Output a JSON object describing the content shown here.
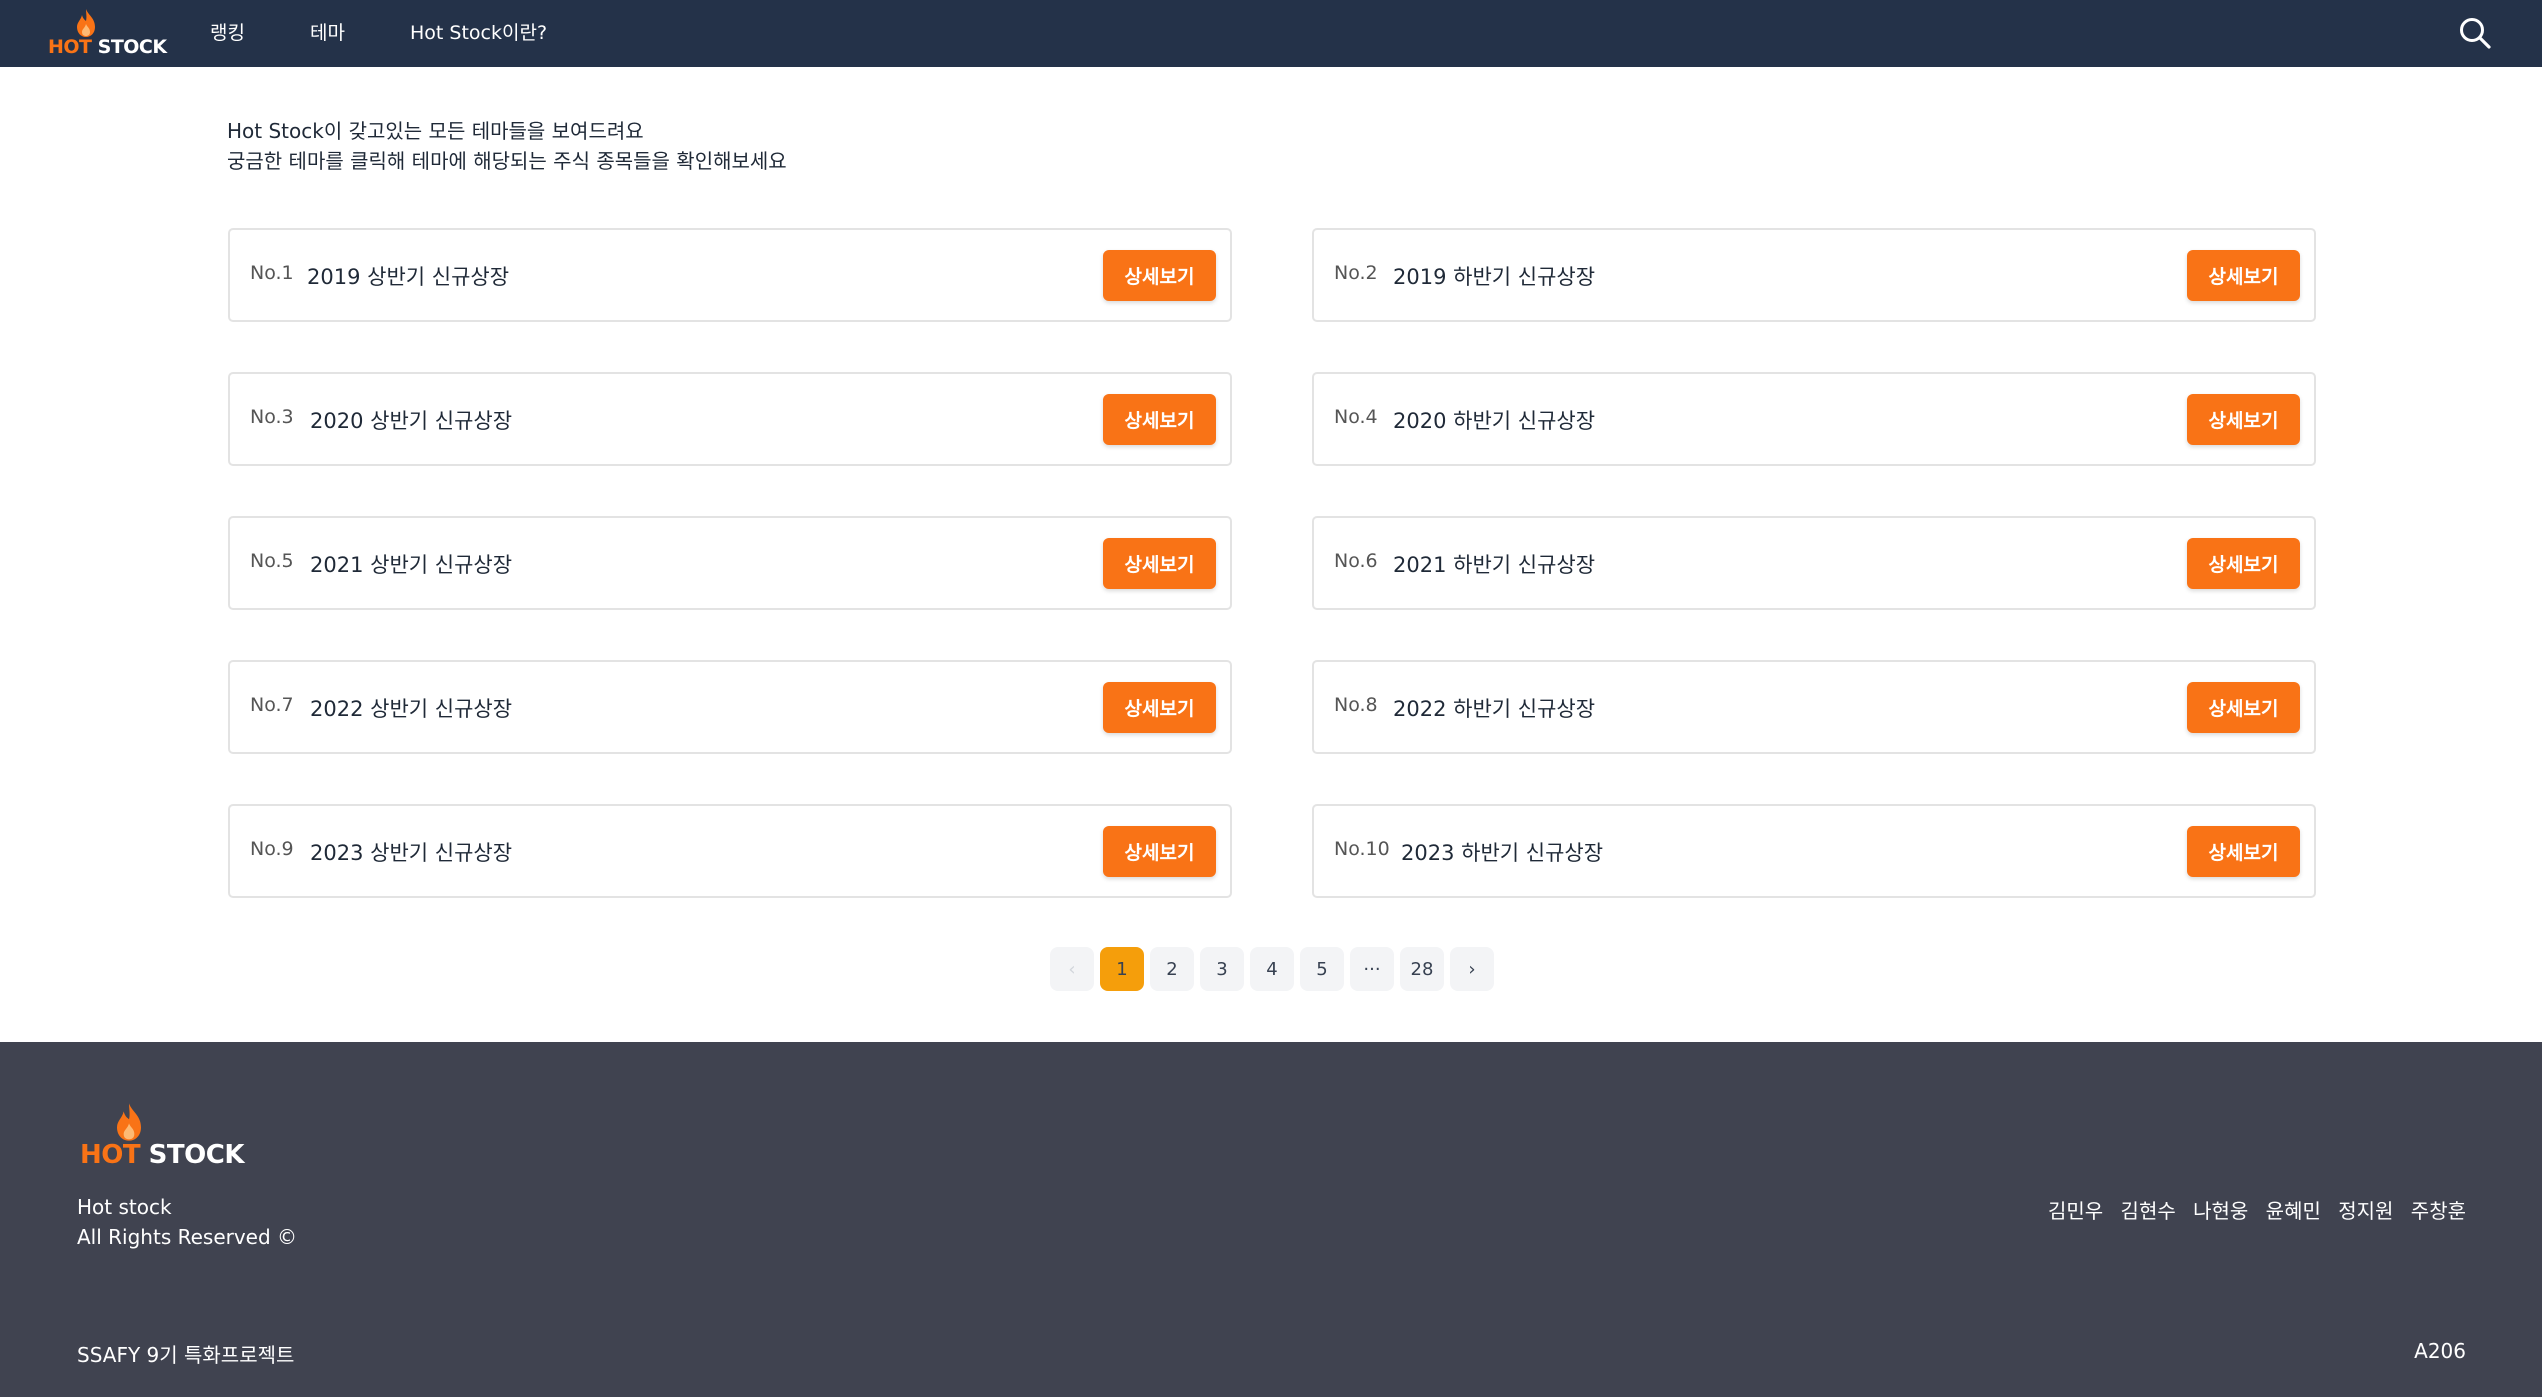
{
  "colors": {
    "header_bg": "#243249",
    "accent": "#f97316",
    "page_active": "#f59e0b",
    "footer_bg": "#404350"
  },
  "header": {
    "logo_hot": "HOT",
    "logo_stock": "STOCK",
    "nav": [
      "랭킹",
      "테마",
      "Hot Stock이란?"
    ],
    "search_icon": "search-icon"
  },
  "intro": {
    "line1": "Hot Stock이 갖고있는 모든 테마들을 보여드려요",
    "line2": "궁금한 테마를 클릭해 테마에 해당되는 주식 종목들을 확인해보세요"
  },
  "themes": [
    {
      "no": "No.1",
      "title": "2019 상반기 신규상장",
      "button": "상세보기"
    },
    {
      "no": "No.2",
      "title": "2019 하반기 신규상장",
      "button": "상세보기"
    },
    {
      "no": "No.3",
      "title": "2020 상반기 신규상장",
      "button": "상세보기"
    },
    {
      "no": "No.4",
      "title": "2020 하반기 신규상장",
      "button": "상세보기"
    },
    {
      "no": "No.5",
      "title": "2021 상반기 신규상장",
      "button": "상세보기"
    },
    {
      "no": "No.6",
      "title": "2021 하반기 신규상장",
      "button": "상세보기"
    },
    {
      "no": "No.7",
      "title": "2022 상반기 신규상장",
      "button": "상세보기"
    },
    {
      "no": "No.8",
      "title": "2022 하반기 신규상장",
      "button": "상세보기"
    },
    {
      "no": "No.9",
      "title": "2023 상반기 신규상장",
      "button": "상세보기"
    },
    {
      "no": "No.10",
      "title": "2023 하반기 신규상장",
      "button": "상세보기"
    }
  ],
  "pagination": {
    "prev": "‹",
    "pages": [
      "1",
      "2",
      "3",
      "4",
      "5",
      "···",
      "28"
    ],
    "next": "›",
    "current": "1"
  },
  "footer": {
    "logo_hot": "HOT",
    "logo_stock": "STOCK",
    "name": "Hot stock",
    "rights": "All Rights Reserved ©",
    "members": [
      "김민우",
      "김현수",
      "나현웅",
      "윤혜민",
      "정지원",
      "주창훈"
    ],
    "project": "SSAFY 9기 특화프로젝트",
    "team": "A206"
  }
}
